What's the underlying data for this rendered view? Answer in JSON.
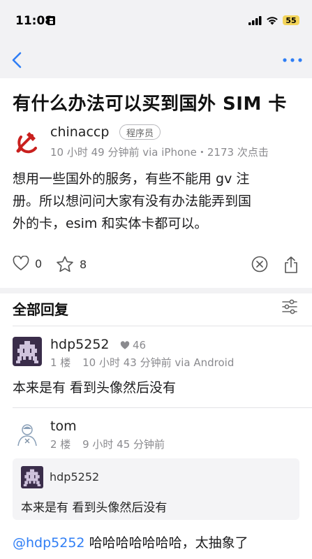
{
  "status_bar": {
    "time": "11:08",
    "battery": "55",
    "icons": [
      "lock-icon",
      "signal-icon",
      "wifi-icon",
      "battery-icon"
    ]
  },
  "nav": {
    "back_icon": "chevron-left-icon",
    "more_icon": "more-dots-icon",
    "accent": "#2f7ef5"
  },
  "post": {
    "title": "有什么办法可以买到国外 SIM 卡",
    "author": "chinaccp",
    "badge": "程序员",
    "meta": "10 小时 49 分钟前 via iPhone・2173 次点击",
    "content_line1": "想用一些国外的服务，有些不能用 gv 注",
    "content_line2": "册。所以想问问大家有没有办法能弄到国",
    "content_line3": "外的卡，esim 和实体卡都可以。",
    "likes": "0",
    "favorites": "8"
  },
  "replies_section": {
    "title": "全部回复",
    "filter_icon": "sliders-icon"
  },
  "replies": [
    {
      "name": "hdp5252",
      "likes": "46",
      "floor": "1 楼",
      "time": "10 小时 43 分钟前 via Android",
      "text": "本来是有 看到头像然后没有"
    },
    {
      "name": "tom",
      "floor": "2 楼",
      "time": "9 小时 45 分钟前",
      "quote_name": "hdp5252",
      "quote_text": "本来是有 看到头像然后没有",
      "mention": "@hdp5252",
      "text": " 哈哈哈哈哈哈哈，太抽象了"
    }
  ]
}
